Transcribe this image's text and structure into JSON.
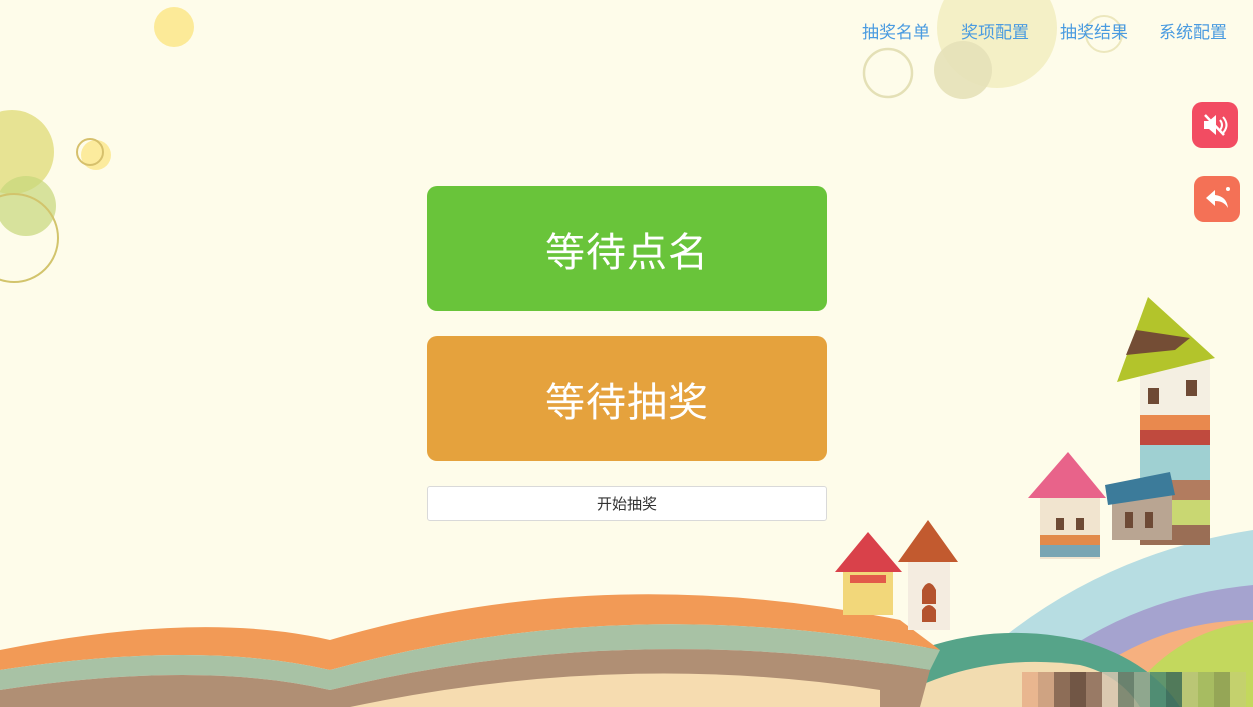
{
  "nav": {
    "items": [
      {
        "label": "抽奖名单"
      },
      {
        "label": "奖项配置"
      },
      {
        "label": "抽奖结果"
      },
      {
        "label": "系统配置"
      }
    ]
  },
  "main": {
    "name_panel_text": "等待点名",
    "prize_panel_text": "等待抽奖",
    "start_button_label": "开始抽奖"
  },
  "side_buttons": {
    "mute_icon": "speaker-muted-icon",
    "back_icon": "reply-icon"
  },
  "colors": {
    "background": "#fefcea",
    "nav_link": "#4a9be0",
    "name_panel": "#69c43a",
    "prize_panel": "#e5a23d",
    "mute_button": "#f24c62",
    "back_button": "#f47156"
  }
}
